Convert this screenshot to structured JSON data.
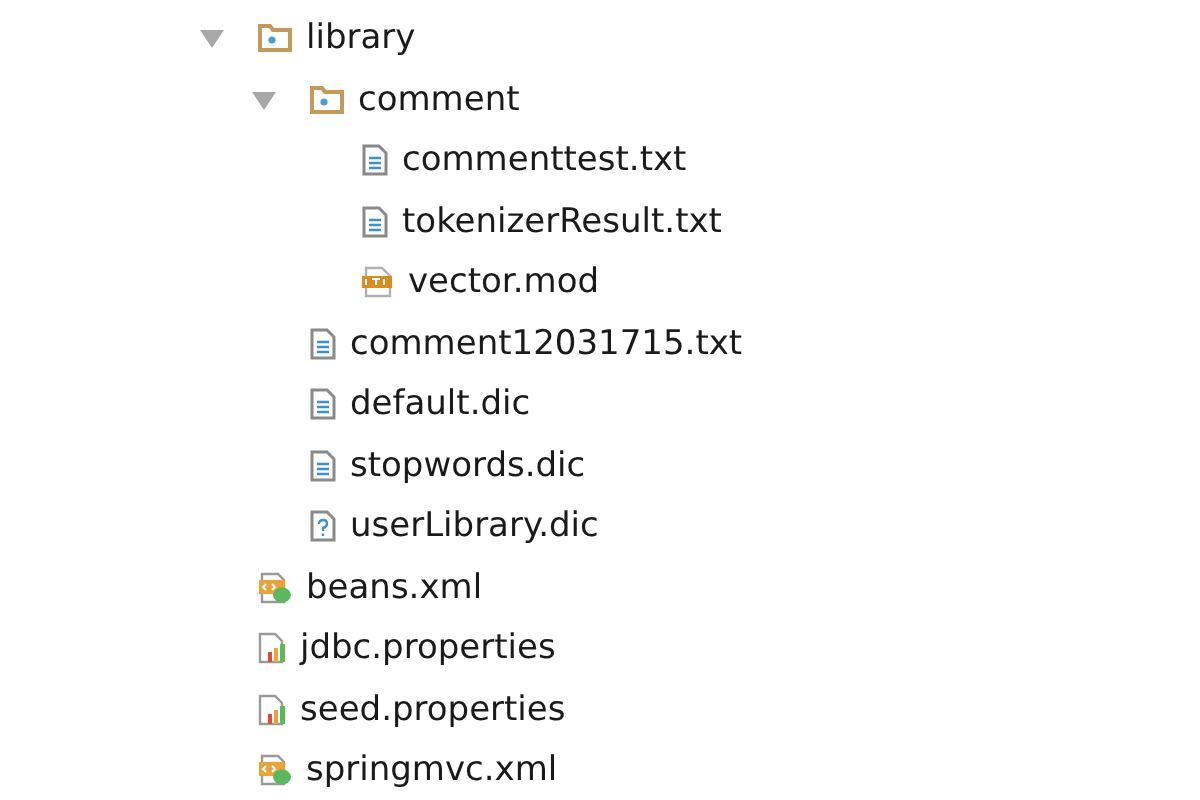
{
  "tree": [
    {
      "label": "library",
      "kind": "folder",
      "expanded": true,
      "children": [
        {
          "label": "comment",
          "kind": "folder",
          "expanded": true,
          "children": [
            {
              "label": "commenttest.txt",
              "kind": "text"
            },
            {
              "label": "tokenizerResult.txt",
              "kind": "text"
            },
            {
              "label": "vector.mod",
              "kind": "dtd"
            }
          ]
        },
        {
          "label": "comment12031715.txt",
          "kind": "text"
        },
        {
          "label": "default.dic",
          "kind": "text"
        },
        {
          "label": "stopwords.dic",
          "kind": "text"
        },
        {
          "label": "userLibrary.dic",
          "kind": "unknown"
        }
      ]
    },
    {
      "label": "beans.xml",
      "kind": "spring-xml"
    },
    {
      "label": "jdbc.properties",
      "kind": "properties"
    },
    {
      "label": "seed.properties",
      "kind": "properties"
    },
    {
      "label": "springmvc.xml",
      "kind": "spring-xml"
    }
  ]
}
